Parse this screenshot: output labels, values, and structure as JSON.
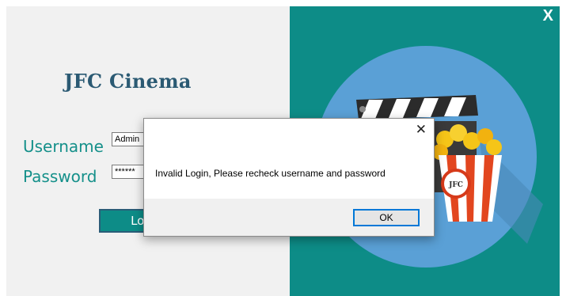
{
  "window": {
    "close_label": "X"
  },
  "app": {
    "title": "JFC Cinema"
  },
  "form": {
    "username_label": "Username",
    "username_value": "Admin",
    "password_label": "Password",
    "password_value": "******",
    "login_label": "Log"
  },
  "logo": {
    "text": "JFC"
  },
  "dialog": {
    "close_glyph": "✕",
    "message": "Invalid Login, Please recheck username and password",
    "ok_label": "OK"
  },
  "colors": {
    "teal_panel": "#0d8c87",
    "circle": "#5aa0d6",
    "label_teal": "#15908a",
    "title_blue": "#2b5a73",
    "ok_border": "#0078d7"
  }
}
